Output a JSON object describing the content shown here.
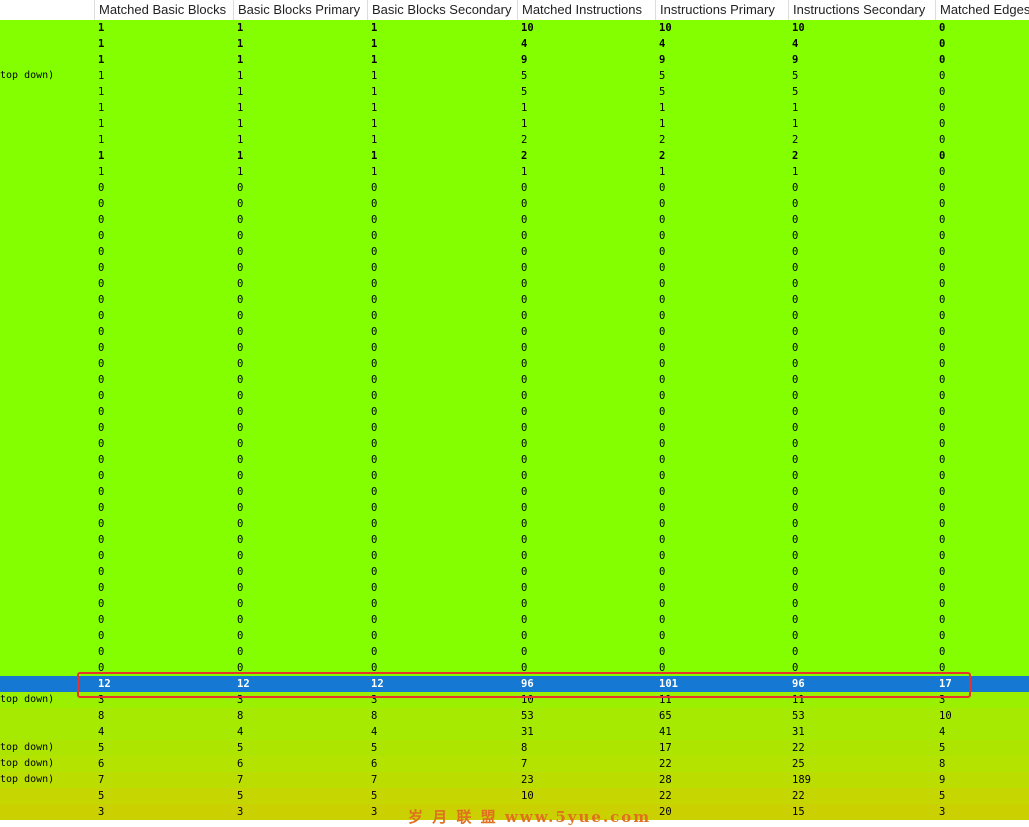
{
  "columns": [
    "",
    "Matched Basic Blocks",
    "Basic Blocks Primary",
    "Basic Blocks Secondary",
    "Matched Instructions",
    "Instructions Primary",
    "Instructions Secondary",
    "Matched Edges"
  ],
  "rows": [
    {
      "name": "",
      "vals": [
        "1",
        "1",
        "1",
        "10",
        "10",
        "10",
        "0"
      ],
      "bold": true,
      "tone": "g0"
    },
    {
      "name": "",
      "vals": [
        "1",
        "1",
        "1",
        "4",
        "4",
        "4",
        "0"
      ],
      "bold": true,
      "tone": "g0"
    },
    {
      "name": "",
      "vals": [
        "1",
        "1",
        "1",
        "9",
        "9",
        "9",
        "0"
      ],
      "bold": true,
      "tone": "g0"
    },
    {
      "name": "top down)",
      "vals": [
        "1",
        "1",
        "1",
        "5",
        "5",
        "5",
        "0"
      ],
      "bold": false,
      "tone": "g0"
    },
    {
      "name": "",
      "vals": [
        "1",
        "1",
        "1",
        "5",
        "5",
        "5",
        "0"
      ],
      "bold": false,
      "tone": "g0"
    },
    {
      "name": "",
      "vals": [
        "1",
        "1",
        "1",
        "1",
        "1",
        "1",
        "0"
      ],
      "bold": false,
      "tone": "g0"
    },
    {
      "name": "",
      "vals": [
        "1",
        "1",
        "1",
        "1",
        "1",
        "1",
        "0"
      ],
      "bold": false,
      "tone": "g0"
    },
    {
      "name": "",
      "vals": [
        "1",
        "1",
        "1",
        "2",
        "2",
        "2",
        "0"
      ],
      "bold": false,
      "tone": "g0"
    },
    {
      "name": "",
      "vals": [
        "1",
        "1",
        "1",
        "2",
        "2",
        "2",
        "0"
      ],
      "bold": true,
      "tone": "g0"
    },
    {
      "name": "",
      "vals": [
        "1",
        "1",
        "1",
        "1",
        "1",
        "1",
        "0"
      ],
      "bold": false,
      "tone": "g0"
    },
    {
      "name": "",
      "vals": [
        "0",
        "0",
        "0",
        "0",
        "0",
        "0",
        "0"
      ],
      "bold": false,
      "tone": "g0"
    },
    {
      "name": "",
      "vals": [
        "0",
        "0",
        "0",
        "0",
        "0",
        "0",
        "0"
      ],
      "bold": false,
      "tone": "g0"
    },
    {
      "name": "",
      "vals": [
        "0",
        "0",
        "0",
        "0",
        "0",
        "0",
        "0"
      ],
      "bold": false,
      "tone": "g0"
    },
    {
      "name": "",
      "vals": [
        "0",
        "0",
        "0",
        "0",
        "0",
        "0",
        "0"
      ],
      "bold": false,
      "tone": "g0"
    },
    {
      "name": "",
      "vals": [
        "0",
        "0",
        "0",
        "0",
        "0",
        "0",
        "0"
      ],
      "bold": false,
      "tone": "g0"
    },
    {
      "name": "",
      "vals": [
        "0",
        "0",
        "0",
        "0",
        "0",
        "0",
        "0"
      ],
      "bold": false,
      "tone": "g0"
    },
    {
      "name": "",
      "vals": [
        "0",
        "0",
        "0",
        "0",
        "0",
        "0",
        "0"
      ],
      "bold": false,
      "tone": "g0"
    },
    {
      "name": "",
      "vals": [
        "0",
        "0",
        "0",
        "0",
        "0",
        "0",
        "0"
      ],
      "bold": false,
      "tone": "g0"
    },
    {
      "name": "",
      "vals": [
        "0",
        "0",
        "0",
        "0",
        "0",
        "0",
        "0"
      ],
      "bold": false,
      "tone": "g0"
    },
    {
      "name": "",
      "vals": [
        "0",
        "0",
        "0",
        "0",
        "0",
        "0",
        "0"
      ],
      "bold": false,
      "tone": "g0"
    },
    {
      "name": "",
      "vals": [
        "0",
        "0",
        "0",
        "0",
        "0",
        "0",
        "0"
      ],
      "bold": false,
      "tone": "g0"
    },
    {
      "name": "",
      "vals": [
        "0",
        "0",
        "0",
        "0",
        "0",
        "0",
        "0"
      ],
      "bold": false,
      "tone": "g0"
    },
    {
      "name": "",
      "vals": [
        "0",
        "0",
        "0",
        "0",
        "0",
        "0",
        "0"
      ],
      "bold": false,
      "tone": "g0"
    },
    {
      "name": "",
      "vals": [
        "0",
        "0",
        "0",
        "0",
        "0",
        "0",
        "0"
      ],
      "bold": false,
      "tone": "g0"
    },
    {
      "name": "",
      "vals": [
        "0",
        "0",
        "0",
        "0",
        "0",
        "0",
        "0"
      ],
      "bold": false,
      "tone": "g0"
    },
    {
      "name": "",
      "vals": [
        "0",
        "0",
        "0",
        "0",
        "0",
        "0",
        "0"
      ],
      "bold": false,
      "tone": "g0"
    },
    {
      "name": "",
      "vals": [
        "0",
        "0",
        "0",
        "0",
        "0",
        "0",
        "0"
      ],
      "bold": false,
      "tone": "g0"
    },
    {
      "name": "",
      "vals": [
        "0",
        "0",
        "0",
        "0",
        "0",
        "0",
        "0"
      ],
      "bold": false,
      "tone": "g0"
    },
    {
      "name": "",
      "vals": [
        "0",
        "0",
        "0",
        "0",
        "0",
        "0",
        "0"
      ],
      "bold": false,
      "tone": "g0"
    },
    {
      "name": "",
      "vals": [
        "0",
        "0",
        "0",
        "0",
        "0",
        "0",
        "0"
      ],
      "bold": false,
      "tone": "g0"
    },
    {
      "name": "",
      "vals": [
        "0",
        "0",
        "0",
        "0",
        "0",
        "0",
        "0"
      ],
      "bold": false,
      "tone": "g0"
    },
    {
      "name": "",
      "vals": [
        "0",
        "0",
        "0",
        "0",
        "0",
        "0",
        "0"
      ],
      "bold": false,
      "tone": "g0"
    },
    {
      "name": "",
      "vals": [
        "0",
        "0",
        "0",
        "0",
        "0",
        "0",
        "0"
      ],
      "bold": false,
      "tone": "g0"
    },
    {
      "name": "",
      "vals": [
        "0",
        "0",
        "0",
        "0",
        "0",
        "0",
        "0"
      ],
      "bold": false,
      "tone": "g0"
    },
    {
      "name": "",
      "vals": [
        "0",
        "0",
        "0",
        "0",
        "0",
        "0",
        "0"
      ],
      "bold": false,
      "tone": "g0"
    },
    {
      "name": "",
      "vals": [
        "0",
        "0",
        "0",
        "0",
        "0",
        "0",
        "0"
      ],
      "bold": false,
      "tone": "g0"
    },
    {
      "name": "",
      "vals": [
        "0",
        "0",
        "0",
        "0",
        "0",
        "0",
        "0"
      ],
      "bold": false,
      "tone": "g0"
    },
    {
      "name": "",
      "vals": [
        "0",
        "0",
        "0",
        "0",
        "0",
        "0",
        "0"
      ],
      "bold": false,
      "tone": "g0"
    },
    {
      "name": "",
      "vals": [
        "0",
        "0",
        "0",
        "0",
        "0",
        "0",
        "0"
      ],
      "bold": false,
      "tone": "g0"
    },
    {
      "name": "",
      "vals": [
        "0",
        "0",
        "0",
        "0",
        "0",
        "0",
        "0"
      ],
      "bold": false,
      "tone": "g0"
    },
    {
      "name": "",
      "vals": [
        "0",
        "0",
        "0",
        "0",
        "0",
        "0",
        "0"
      ],
      "bold": false,
      "tone": "g0"
    },
    {
      "name": "",
      "vals": [
        "12",
        "12",
        "12",
        "96",
        "101",
        "96",
        "17"
      ],
      "bold": true,
      "tone": "sel"
    },
    {
      "name": "top down)",
      "vals": [
        "3",
        "3",
        "3",
        "10",
        "11",
        "11",
        "3"
      ],
      "bold": false,
      "tone": "g1"
    },
    {
      "name": "",
      "vals": [
        "8",
        "8",
        "8",
        "53",
        "65",
        "53",
        "10"
      ],
      "bold": false,
      "tone": "g2"
    },
    {
      "name": "",
      "vals": [
        "4",
        "4",
        "4",
        "31",
        "41",
        "31",
        "4"
      ],
      "bold": false,
      "tone": "g2"
    },
    {
      "name": "top down)",
      "vals": [
        "5",
        "5",
        "5",
        "8",
        "17",
        "22",
        "5"
      ],
      "bold": false,
      "tone": "g3"
    },
    {
      "name": "top down)",
      "vals": [
        "6",
        "6",
        "6",
        "7",
        "22",
        "25",
        "8"
      ],
      "bold": false,
      "tone": "g4"
    },
    {
      "name": "top down)",
      "vals": [
        "7",
        "7",
        "7",
        "23",
        "28",
        "189",
        "9"
      ],
      "bold": false,
      "tone": "g5"
    },
    {
      "name": "",
      "vals": [
        "5",
        "5",
        "5",
        "10",
        "22",
        "22",
        "5"
      ],
      "bold": false,
      "tone": "g6"
    },
    {
      "name": "",
      "vals": [
        "3",
        "3",
        "3",
        "",
        "20",
        "15",
        "3"
      ],
      "bold": false,
      "tone": "g7"
    }
  ],
  "watermark": "岁 月 联 盟  www.5yue.com",
  "colors": {
    "match_green": "#84ff00",
    "selection_blue": "#1578d2",
    "highlight_red": "#e8322d"
  }
}
